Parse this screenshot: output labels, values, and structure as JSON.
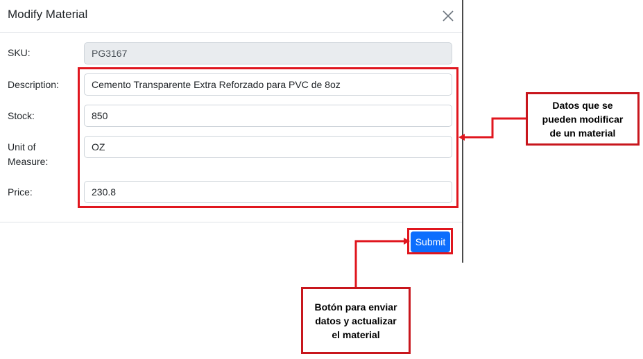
{
  "modal": {
    "title": "Modify Material",
    "close_icon": "close-icon"
  },
  "form": {
    "sku": {
      "label": "SKU:",
      "value": "PG3167"
    },
    "description": {
      "label": "Description:",
      "value": "Cemento Transparente Extra Reforzado para PVC de 8oz"
    },
    "stock": {
      "label": "Stock:",
      "value": "850"
    },
    "unit": {
      "label_line1": "Unit of",
      "label_line2": "Measure:",
      "value": "OZ"
    },
    "price": {
      "label": "Price:",
      "value": "230.8"
    }
  },
  "footer": {
    "submit_label": "Submit"
  },
  "annotations": {
    "fields_note": [
      "Datos que se",
      "pueden modificar",
      "de un material"
    ],
    "submit_note": [
      "Botón para enviar",
      "datos y actualizar",
      "el material"
    ]
  },
  "colors": {
    "primary": "#0d6efd",
    "annotation_red": "#e0161e",
    "readonly_bg": "#e9ecef"
  }
}
